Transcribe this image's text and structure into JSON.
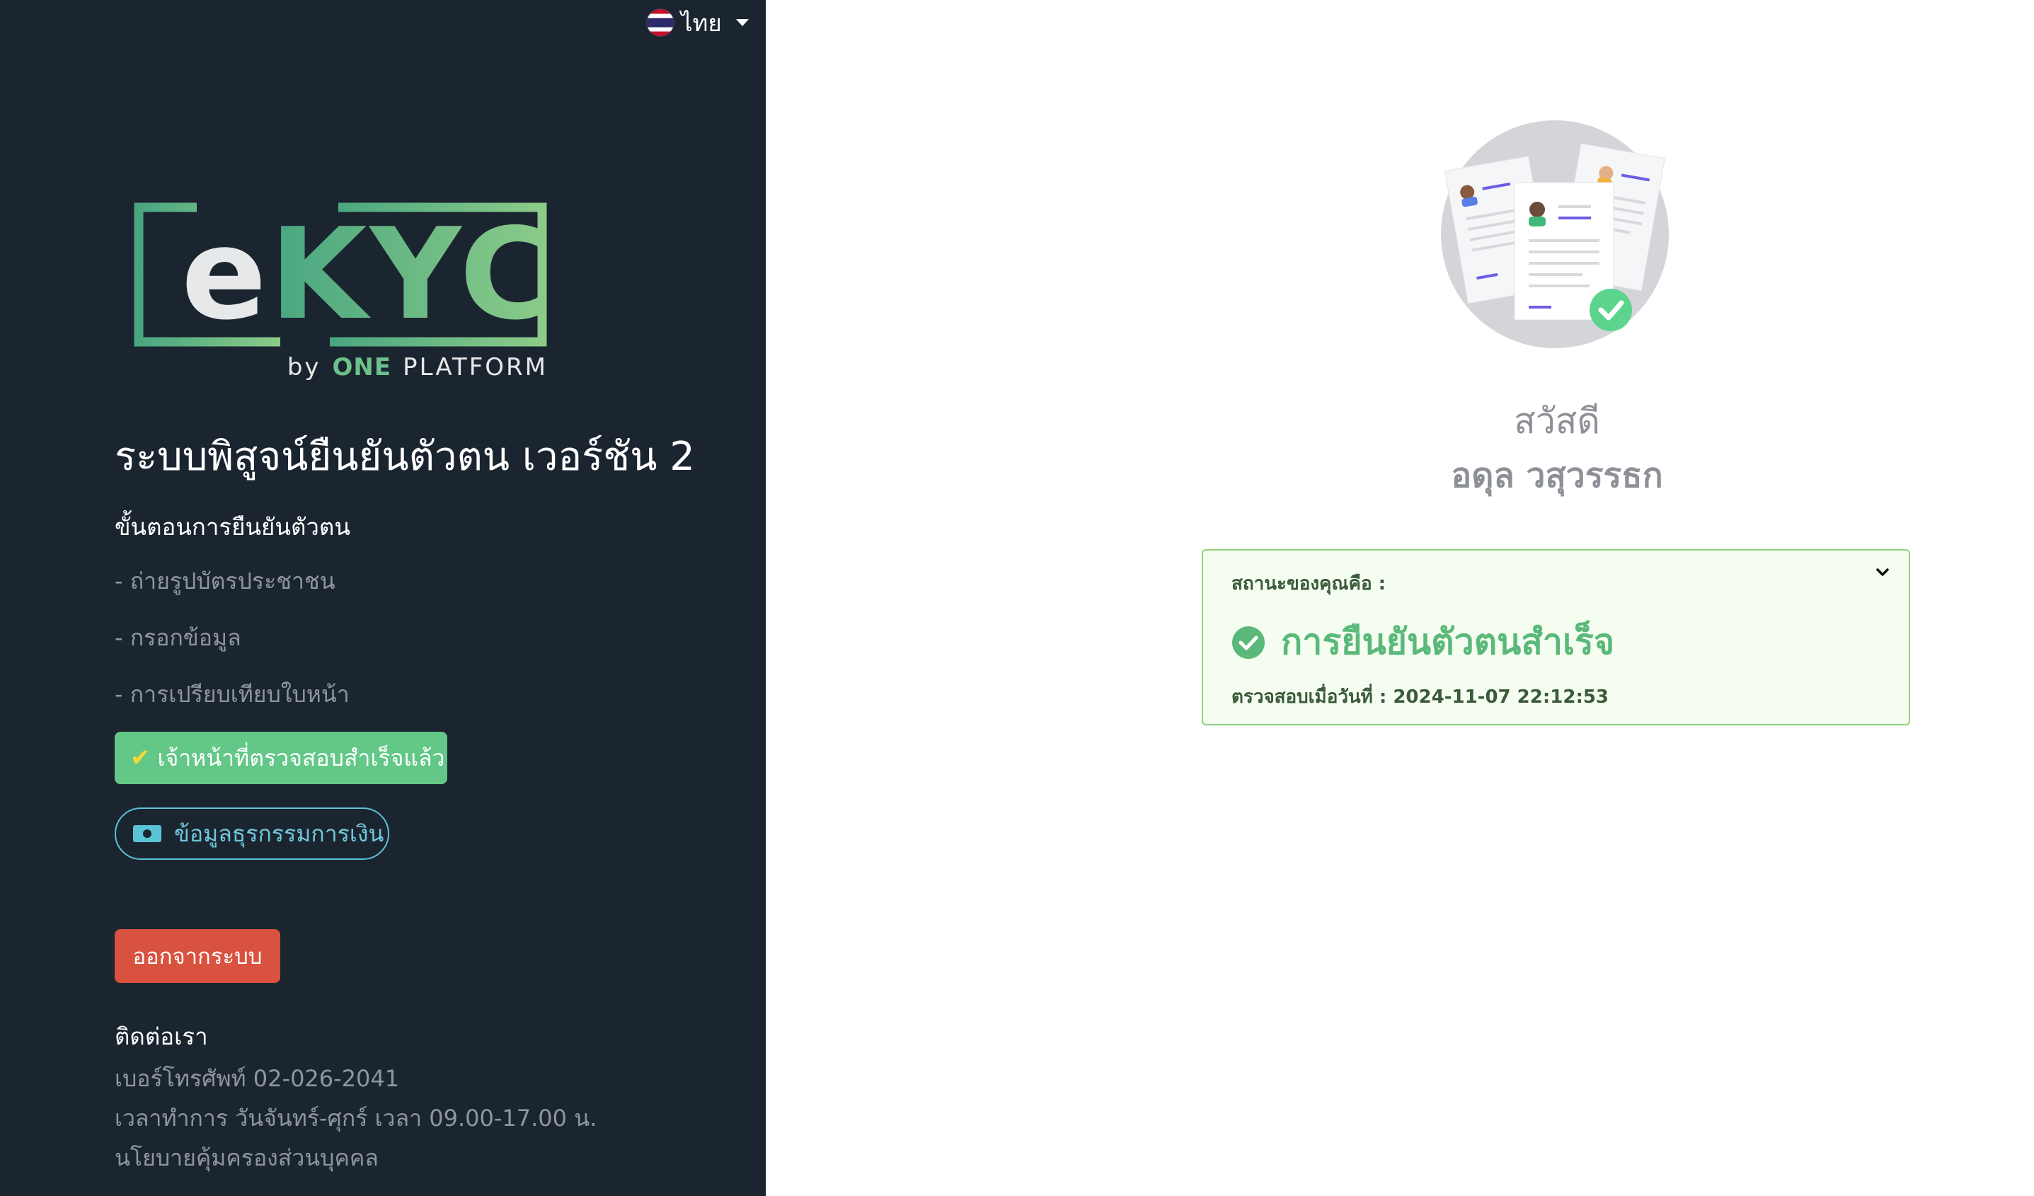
{
  "language": {
    "label": "ไทย",
    "flag": "thai-flag-icon"
  },
  "logo": {
    "letter_e": "e",
    "letters_kyc": "KYC",
    "by": "by",
    "brand_one": "ONE",
    "brand_platform": "PLATFORM"
  },
  "sidebar": {
    "title": "ระบบพิสูจน์ยืนยันตัวตน เวอร์ชัน 2",
    "steps_heading": "ขั้นตอนการยืนยันตัวตน",
    "steps": [
      "- ถ่ายรูปบัตรประชาชน",
      "- กรอกข้อมูล",
      "- การเปรียบเทียบใบหน้า"
    ],
    "verified_button": "เจ้าหน้าที่ตรวจสอบสำเร็จแล้ว",
    "finance_button": "ข้อมูลธุรกรรมการเงิน",
    "logout_button": "ออกจากระบบ",
    "contact_heading": "ติดต่อเรา",
    "contact_lines": [
      "เบอร์โทรศัพท์ 02-026-2041",
      "เวลาทำการ วันจันทร์-ศุกร์ เวลา 09.00-17.00 น.",
      "นโยบายคุ้มครองส่วนบุคคล"
    ]
  },
  "main": {
    "greeting": "สวัสดี",
    "user_name": "อดุล วสุวรรธก",
    "status": {
      "label": "สถานะของคุณคือ :",
      "value": "การยืนยันตัวตนสำเร็จ",
      "date_line": "ตรวจสอบเมื่อวันที่ : 2024-11-07 22:12:53"
    }
  },
  "colors": {
    "sidebar_bg": "#1b2530",
    "accent_green": "#62c787",
    "accent_cyan": "#5bc3d6",
    "danger": "#d9523f",
    "status_bg": "#f5fdf0",
    "status_border": "#8fd27e"
  }
}
